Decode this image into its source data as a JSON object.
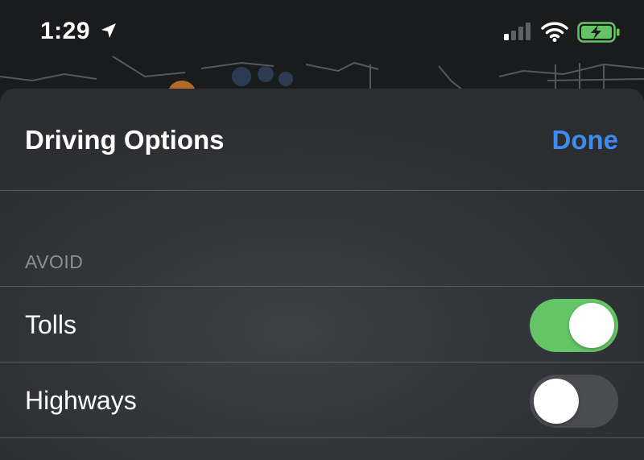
{
  "status_bar": {
    "time": "1:29",
    "icons": [
      "location-arrow-icon",
      "cellular-signal-icon",
      "wifi-icon",
      "battery-charging-icon"
    ]
  },
  "sheet": {
    "title": "Driving Options",
    "done_label": "Done"
  },
  "avoid": {
    "header": "AVOID",
    "options": [
      {
        "label": "Tolls",
        "enabled": true
      },
      {
        "label": "Highways",
        "enabled": false
      }
    ]
  },
  "colors": {
    "accent": "#3d8cf1",
    "toggle_on": "#65c466",
    "toggle_off": "#4a4c51",
    "battery": "#65c466"
  }
}
